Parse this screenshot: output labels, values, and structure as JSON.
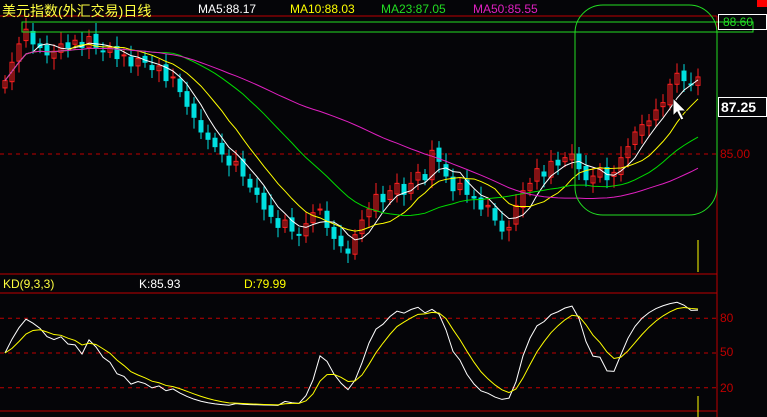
{
  "header": {
    "title": "美元指数(外汇交易)日线",
    "ma5": "MA5:88.17",
    "ma10": "MA10:88.03",
    "ma23": "MA23:87.05",
    "ma50": "MA50:85.55"
  },
  "axis": {
    "price_labels": [
      "85.00"
    ],
    "marker_label": "88.60",
    "current_price": "87.25",
    "kd_labels": [
      "80",
      "50",
      "20"
    ]
  },
  "kd_header": {
    "title": "KD(9,3,3)",
    "k": "K:85.93",
    "d": "D:79.99"
  },
  "colors": {
    "up": "#ff2020",
    "down": "#00e0e0",
    "ma5": "#ffffff",
    "ma10": "#ffff00",
    "ma23": "#00dd00",
    "ma50": "#e020c0",
    "grid": "#c00000",
    "annotation": "#22dd22"
  },
  "chart_data": [
    {
      "type": "candlestick",
      "title": "美元指数(外汇交易)日线",
      "series": [
        {
          "name": "close",
          "values": [
            87.0,
            87.5,
            88.0,
            88.4,
            88.0,
            87.9,
            87.7,
            87.8,
            88.0,
            87.9,
            88.1,
            87.9,
            88.2,
            87.9,
            87.8,
            87.9,
            87.6,
            87.7,
            87.4,
            87.6,
            87.5,
            87.3,
            87.4,
            87.0,
            87.1,
            86.7,
            86.3,
            86.0,
            85.6,
            85.4,
            85.2,
            85.0,
            84.7,
            84.8,
            84.4,
            84.1,
            83.9,
            83.5,
            83.3,
            83.0,
            83.2,
            82.9,
            82.8,
            83.1,
            83.4,
            83.5,
            83.0,
            82.7,
            82.5,
            82.3,
            82.8,
            83.2,
            83.5,
            83.9,
            83.7,
            84.0,
            84.2,
            83.9,
            84.2,
            84.5,
            84.3,
            85.1,
            84.8,
            84.4,
            84.0,
            84.2,
            83.9,
            83.8,
            83.5,
            83.6,
            83.2,
            82.9,
            83.0,
            83.6,
            84.0,
            84.2,
            84.6,
            84.4,
            84.8,
            84.7,
            84.9,
            85.0,
            84.6,
            84.3,
            84.4,
            84.6,
            84.3,
            84.5,
            84.9,
            85.2,
            85.6,
            85.8,
            85.9,
            86.2,
            86.4,
            86.9,
            87.2,
            87.0,
            86.9,
            87.1
          ]
        }
      ],
      "moving_averages": [
        "MA5",
        "MA10",
        "MA23",
        "MA50"
      ],
      "y_ticks": [
        85.0
      ],
      "grid": true
    },
    {
      "type": "line",
      "title": "KD(9,3,3)",
      "series": [
        {
          "name": "K",
          "last": 85.93
        },
        {
          "name": "D",
          "last": 79.99
        }
      ],
      "ylim": [
        0,
        100
      ],
      "y_ticks": [
        20,
        50,
        80
      ]
    }
  ]
}
